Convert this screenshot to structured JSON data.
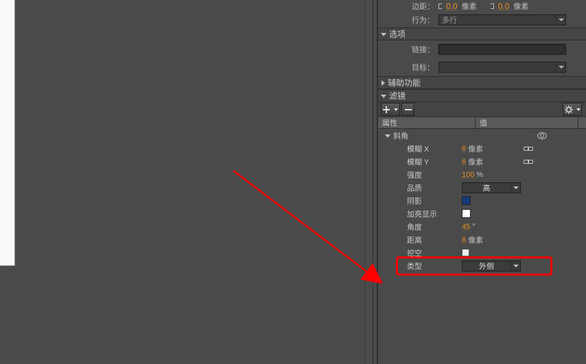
{
  "top": {
    "margin_label": "边距：",
    "left_val": "0.0",
    "right_val": "0.0",
    "unit": "像素",
    "behavior_label": "行为：",
    "behavior_val": "多行"
  },
  "sections": {
    "options": "选项",
    "link_label": "链接：",
    "target_label": "目标：",
    "accessibility": "辅助功能",
    "filters": "滤镜"
  },
  "table": {
    "col_attr": "属性",
    "col_val": "值"
  },
  "bevel": {
    "group": "斜角",
    "blurx": "模糊 X",
    "blury": "模糊 Y",
    "strength": "强度",
    "quality": "品质",
    "shadow": "阴影",
    "highlight": "加亮显示",
    "angle": "角度",
    "distance": "距离",
    "knockout": "挖空",
    "type": "类型",
    "vals": {
      "blurx": "6",
      "blury": "6",
      "strength": "100",
      "quality": "高",
      "angle": "45",
      "distance": "6",
      "type": "外侧"
    },
    "units": {
      "px": "像素",
      "pct": "%",
      "deg": "°"
    },
    "colors": {
      "shadow": "#143a7a",
      "highlight": "#ffffff"
    }
  }
}
